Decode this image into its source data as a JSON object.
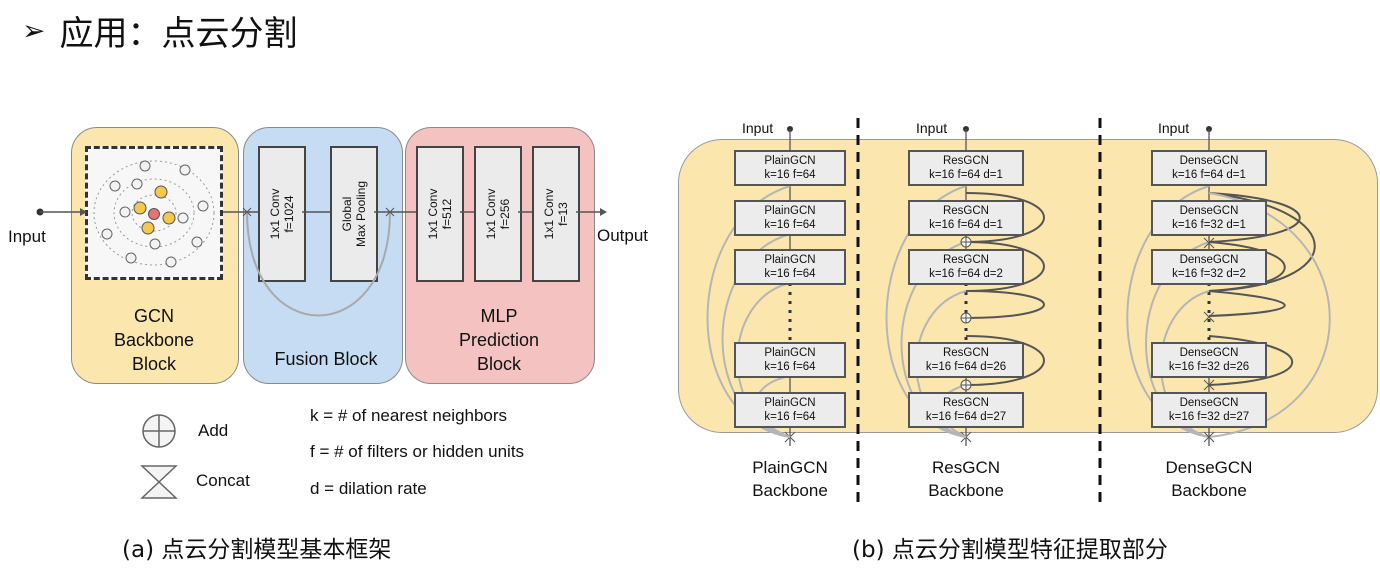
{
  "title": {
    "bullet": "➢",
    "text": "应用：点云分割"
  },
  "panel_a": {
    "input_label": "Input",
    "output_label": "Output",
    "gcn_block_label": [
      "GCN",
      "Backbone",
      "Block"
    ],
    "fusion_block_label": "Fusion Block",
    "fusion_boxes": [
      {
        "line1": "1x1 Conv",
        "line2": "f=1024"
      },
      {
        "line1": "Global",
        "line2": "Max Pooling"
      }
    ],
    "mlp_block_label": [
      "MLP",
      "Prediction",
      "Block"
    ],
    "mlp_boxes": [
      {
        "line1": "1x1 Conv",
        "line2": "f=512"
      },
      {
        "line1": "1x1 Conv",
        "line2": "f=256"
      },
      {
        "line1": "1x1 Conv",
        "line2": "f=13"
      }
    ],
    "legend": {
      "add": "Add",
      "concat": "Concat",
      "notes": [
        "k = # of nearest neighbors",
        "f = # of filters or hidden units",
        "d = dilation rate"
      ]
    },
    "caption": "(a) 点云分割模型基本框架"
  },
  "panel_b": {
    "plain": {
      "input": "Input",
      "boxes": [
        {
          "name": "PlainGCN",
          "params": "k=16 f=64"
        },
        {
          "name": "PlainGCN",
          "params": "k=16 f=64"
        },
        {
          "name": "PlainGCN",
          "params": "k=16 f=64"
        },
        {
          "name": "PlainGCN",
          "params": "k=16 f=64"
        },
        {
          "name": "PlainGCN",
          "params": "k=16 f=64"
        }
      ],
      "label": [
        "PlainGCN",
        "Backbone"
      ]
    },
    "res": {
      "input": "Input",
      "boxes": [
        {
          "name": "ResGCN",
          "params": "k=16 f=64 d=1"
        },
        {
          "name": "ResGCN",
          "params": "k=16 f=64 d=1"
        },
        {
          "name": "ResGCN",
          "params": "k=16 f=64 d=2"
        },
        {
          "name": "ResGCN",
          "params": "k=16 f=64 d=26"
        },
        {
          "name": "ResGCN",
          "params": "k=16 f=64 d=27"
        }
      ],
      "label": [
        "ResGCN",
        "Backbone"
      ]
    },
    "dense": {
      "input": "Input",
      "boxes": [
        {
          "name": "DenseGCN",
          "params": "k=16 f=64 d=1"
        },
        {
          "name": "DenseGCN",
          "params": "k=16 f=32 d=1"
        },
        {
          "name": "DenseGCN",
          "params": "k=16 f=32 d=2"
        },
        {
          "name": "DenseGCN",
          "params": "k=16 f=32 d=26"
        },
        {
          "name": "DenseGCN",
          "params": "k=16 f=32 d=27"
        }
      ],
      "label": [
        "DenseGCN",
        "Backbone"
      ]
    },
    "caption": "(b) 点云分割模型特征提取部分"
  },
  "colors": {
    "gcn_fill": "#fbe7ae",
    "fusion_fill": "#c5dcf2",
    "mlp_fill": "#f5c2c2",
    "backbone_fill": "#fbe7ae",
    "point_yellow": "#f2c94c",
    "point_red": "#e57373"
  }
}
